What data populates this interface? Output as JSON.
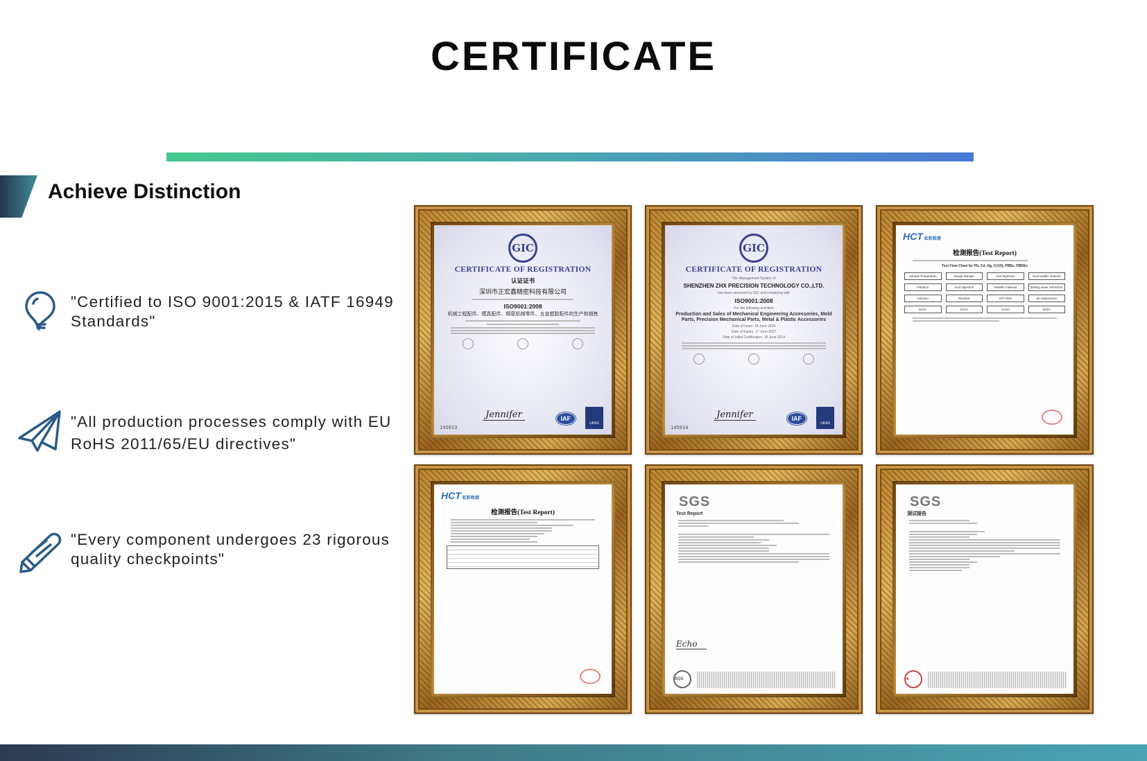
{
  "header": {
    "title": "CERTIFICATE"
  },
  "section": {
    "title": "Achieve Distinction"
  },
  "colors": {
    "accent_start": "#45c98e",
    "accent_end": "#4a78d6",
    "icon": "#2c5a86",
    "bottom_bar_start": "#2b3a52",
    "bottom_bar_end": "#4ba3b3"
  },
  "features": [
    {
      "icon": "lightbulb-icon",
      "text": "\"Certified to ISO 9001:2015 & IATF 16949 Standards\""
    },
    {
      "icon": "paper-plane-icon",
      "text": "\"All production processes comply with EU RoHS 2011/65/EU directives\""
    },
    {
      "icon": "pencil-icon",
      "text": "\"Every component undergoes 23 rigorous quality checkpoints\""
    }
  ],
  "certificates": [
    {
      "logo": "GIC",
      "title": "CERTIFICATE OF REGISTRATION",
      "subtitle": "认证证书",
      "company": "深圳市正宏鑫精密科技有限公司",
      "standard": "ISO9001:2008",
      "scope": "机械工程配件、模具配件、精密机械零件、五金塑胶配件的生产和销售",
      "badge1": "IAF",
      "badge2": "UKAS",
      "number": "145013"
    },
    {
      "logo": "GIC",
      "title": "CERTIFICATE OF REGISTRATION",
      "intro": "The Management System of",
      "company": "SHENZHEN ZHX PRECISION TECHNOLOGY CO.,LTD.",
      "assessed": "has been assessed by GIC and complying with",
      "standard": "ISO9001:2008",
      "activities_label": "For the following activities",
      "scope": "Production and Sales of Mechanical Engineering Accessories, Mold Parts, Precision Mechanical Parts, Metal & Plastic Accessories",
      "issue": "Date of Issue: 18 June 2014",
      "expiry": "Date of Expiry: 17 June 2017",
      "initial": "Date of Initial Certification: 18 June 2014",
      "badge1": "IAF",
      "badge2": "UKAS",
      "number": "145014"
    },
    {
      "logo": "HCT",
      "logo_sub": "虹彩检测",
      "title": "检测报告(Test Report)",
      "chart_title": "Test Flow Chart for Pb, Cd, Hg, Cr(VI), PBBs, PBDEs",
      "boxes": [
        "Sample Preparation",
        "Weigh Sample",
        "Acid digestion",
        "Nonmetallic material",
        "Filtration",
        "Acid digestion",
        "Metallic material",
        "Boiling water extraction",
        "Solution",
        "Residue",
        "ICP-OES",
        "pH adjustment",
        "DATA",
        "DATA",
        "Cr(VI)",
        "DATA"
      ]
    },
    {
      "logo": "HCT",
      "logo_sub": "虹彩检测",
      "title": "检测报告(Test Report)"
    },
    {
      "logo": "SGS",
      "title": "Test Report",
      "signature": "Echo"
    },
    {
      "logo": "SGS",
      "title": "测试报告"
    }
  ]
}
